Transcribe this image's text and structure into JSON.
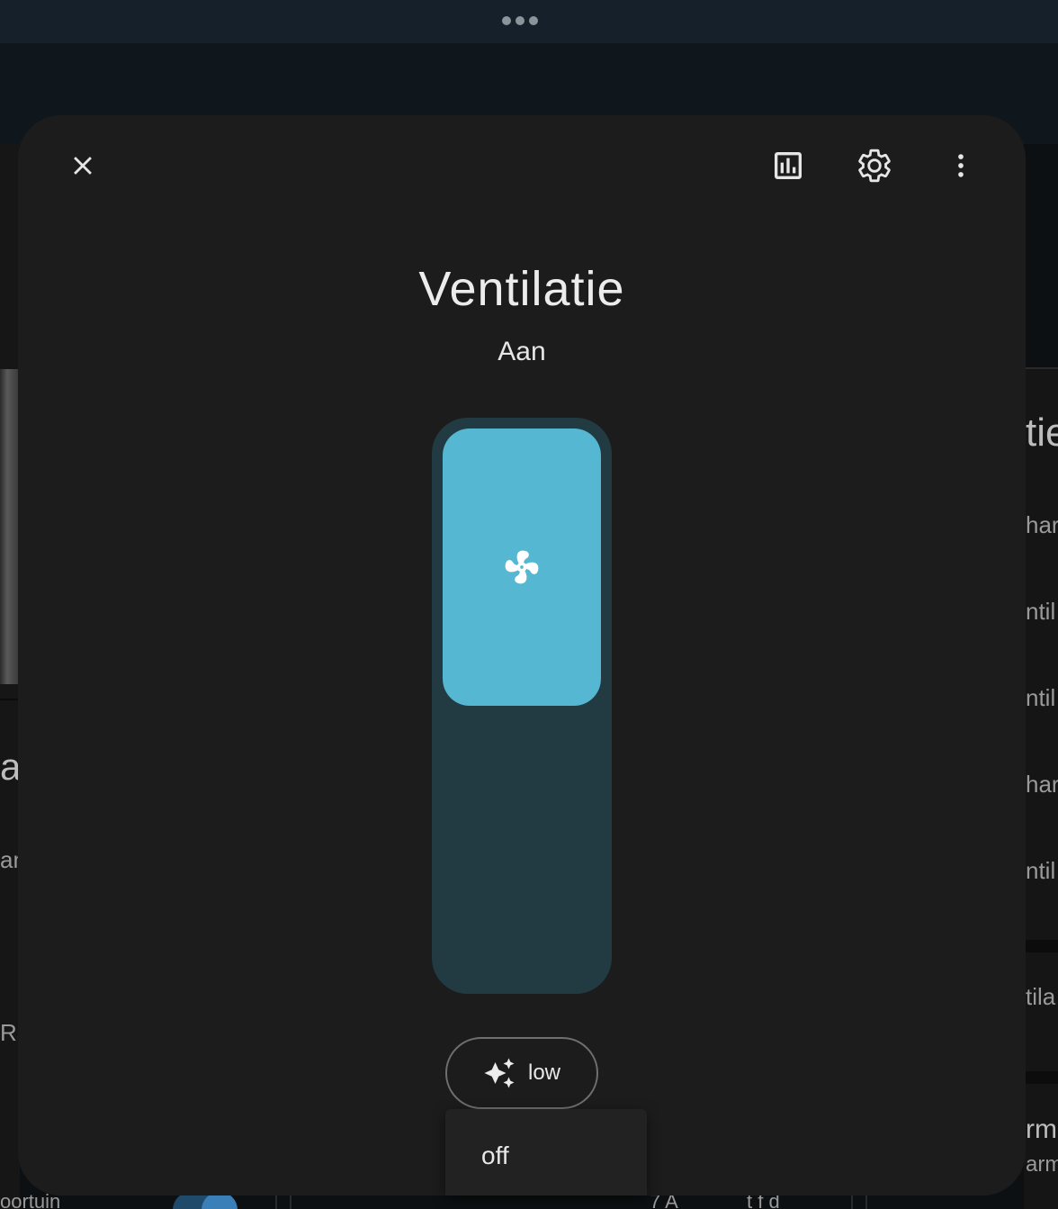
{
  "background": {
    "left_texts": [
      "ar",
      "am",
      "Ra"
    ],
    "right_texts": [
      "tie",
      "har",
      "ntil",
      "ntil",
      "har",
      "ntil",
      "tila",
      "rm",
      "arm"
    ],
    "bottom_texts": [
      "oortuin",
      "7 A",
      "t f  d"
    ]
  },
  "dialog": {
    "title": "Ventilatie",
    "state": "Aan",
    "slider": {
      "level_fraction": 0.5,
      "icon": "fan-icon",
      "fill_color": "#55b7d1",
      "track_color": "#223b42"
    },
    "mode_button": {
      "icon": "auto-sparkles-icon",
      "label": "low"
    },
    "menu": {
      "items": [
        "off"
      ]
    },
    "header_icons": {
      "close": "close-icon",
      "history": "chart-box-icon",
      "settings": "gear-icon",
      "more": "dots-vertical-icon"
    }
  }
}
